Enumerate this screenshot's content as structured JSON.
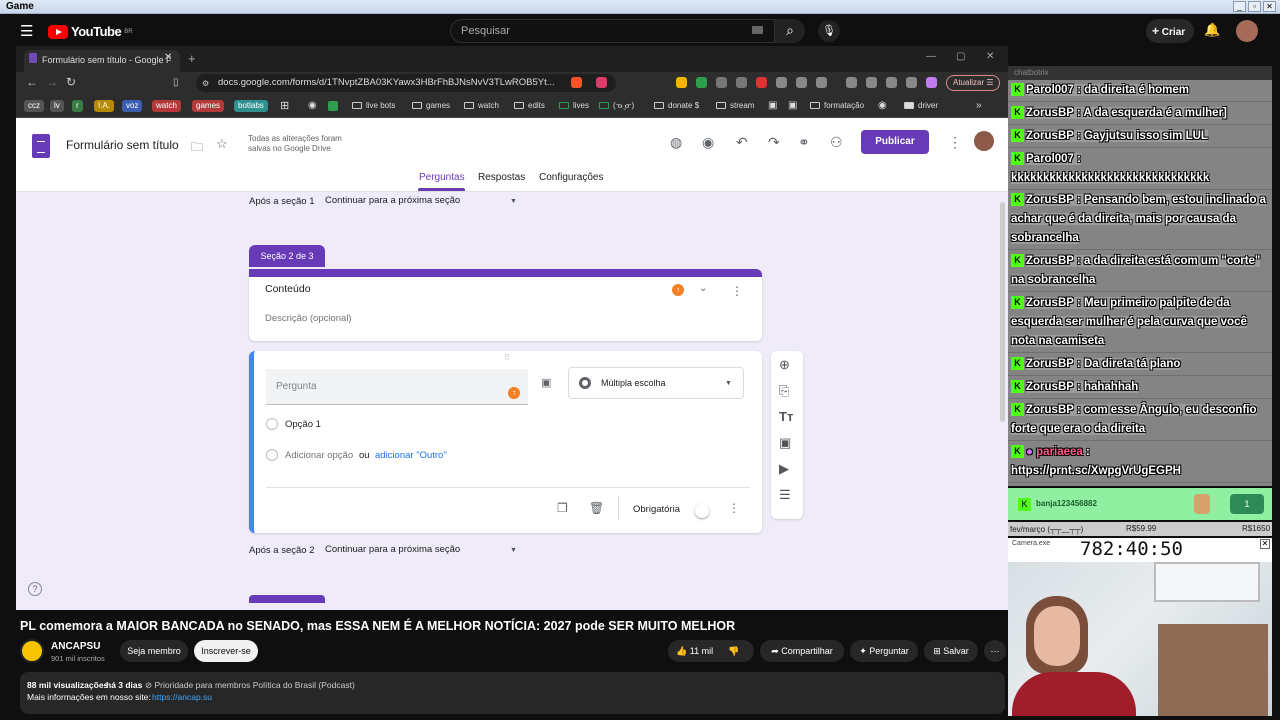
{
  "os": {
    "window_title": "Game",
    "controls": [
      "_",
      "▫",
      "✕"
    ]
  },
  "youtube": {
    "logo_text": "YouTube",
    "region": "BR",
    "search_placeholder": "Pesquisar",
    "create_label": "Criar",
    "video_title": "PL comemora a MAIOR BANCADA no SENADO, mas ESSA NEM É A MELHOR NOTÍCIA: 2027 pode SER MUITO MELHOR",
    "channel_name": "ANCAPSU",
    "subscribers": "901 mil inscritos",
    "member_button": "Seja membro",
    "subscribe_button": "Inscrever-se",
    "likes": "11 mil",
    "share_label": "Compartilhar",
    "ask_label": "Perguntar",
    "save_label": "Salvar",
    "views": "88 mil visualizações",
    "age": "há 3 dias",
    "tags": "⊘ Prioridade para membros  Política do Brasil (Podcast)",
    "more_info": "Mais informações em nosso site:",
    "site_link": "https://ancap.su"
  },
  "browser": {
    "tab_title": "Formulário sem título - Google F",
    "url": "docs.google.com/forms/d/1TNvptZBA03KYawx3HBrFhBJNsNvV3TLwROB5Yt...",
    "update_label": "Atualizar",
    "bookmarks": [
      {
        "label": "ccz",
        "color": "#555"
      },
      {
        "label": "lv",
        "color": "#555"
      },
      {
        "label": "r",
        "color": "#3a7d44"
      },
      {
        "label": "I.A.",
        "color": "#b88a00"
      },
      {
        "label": "voz",
        "color": "#3b5fb0"
      },
      {
        "label": "watch",
        "color": "#b33a3a"
      },
      {
        "label": "games",
        "color": "#b33a3a"
      },
      {
        "label": "botlabs",
        "color": "#2f8f8f"
      }
    ],
    "folders": [
      "live bots",
      "games",
      "watch",
      "edits",
      "lives",
      "(ᓀ ̫ᓂ)",
      "donate $",
      "stream",
      "formatação",
      "driver"
    ]
  },
  "forms": {
    "title": "Formulário sem título",
    "saved_status": "Todas as alterações foram salvas no Google Drive",
    "publish_label": "Publicar",
    "tabs": [
      "Perguntas",
      "Respostas",
      "Configurações"
    ],
    "after_section_1_label": "Após a seção 1",
    "after_section_1_value": "Continuar para a próxima seção",
    "section_badge": "Seção 2 de 3",
    "section_title": "Conteúdo",
    "section_desc_placeholder": "Descrição (opcional)",
    "question_placeholder": "Pergunta",
    "question_type": "Múltipla escolha",
    "option_1": "Opção 1",
    "add_option": "Adicionar opção",
    "or_label": "ou",
    "add_other": "adicionar \"Outro\"",
    "required_label": "Obrigatória",
    "after_section_2_label": "Após a seção 2",
    "after_section_2_value": "Continuar para a próxima seção"
  },
  "chat": {
    "header": "chatbotrix",
    "messages": [
      {
        "user": "Parol007",
        "text": "da direita é homem"
      },
      {
        "user": "ZorusBP",
        "text": "A da esquerda é a mulher]"
      },
      {
        "user": "ZorusBP",
        "text": "Gayjutsu isso sim LUL"
      },
      {
        "user": "Parol007",
        "text": "kkkkkkkkkkkkkkkkkkkkkkkkkkkkkkk"
      },
      {
        "user": "ZorusBP",
        "text": "Pensando bem, estou inclinado a achar que é da direita, mais por causa da sobrancelha"
      },
      {
        "user": "ZorusBP",
        "text": "a da direita está com um \"corte\" na sobrancelha"
      },
      {
        "user": "ZorusBP",
        "text": "Meu primeiro palpite de da esquerda ser mulher é pela curva que você nota na camiseta"
      },
      {
        "user": "ZorusBP",
        "text": "Da direta tá plano"
      },
      {
        "user": "ZorusBP",
        "text": "hahahhah"
      },
      {
        "user": "ZorusBP",
        "text": "com esse Ângulo, eu desconfio forte que era o da direita"
      },
      {
        "user": "pariaeea",
        "text": "https://prnt.sc/XwpgVrUgEGPH"
      }
    ],
    "notice_user": "banja123456882",
    "notice_count": "1"
  },
  "stream": {
    "goal_label": "fev/março (┬┬﹏┬┬)",
    "goal_current": "R$59.99",
    "goal_target": "R$1650",
    "camera_label": "Camera.exe",
    "timer": "782:40:50"
  }
}
